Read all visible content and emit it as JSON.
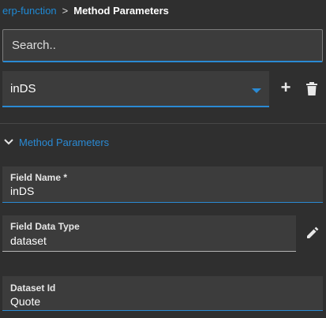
{
  "breadcrumb": {
    "parent": "erp-function",
    "separator": ">",
    "current": "Method Parameters"
  },
  "search": {
    "placeholder": "Search..",
    "value": ""
  },
  "dataset_select": {
    "value": "inDS",
    "caret_icon": "caret-down-icon"
  },
  "actions": {
    "add_icon": "plus-icon",
    "add_label": "+",
    "delete_icon": "trash-icon"
  },
  "section": {
    "title": "Method Parameters",
    "icon": "chevron-down-icon",
    "expanded": true
  },
  "fields": {
    "field_name": {
      "label": "Field Name *",
      "value": "inDS"
    },
    "field_data_type": {
      "label": "Field Data Type",
      "value": "dataset",
      "edit_icon": "pencil-icon"
    },
    "dataset_id": {
      "label": "Dataset Id",
      "value": "Quote"
    }
  },
  "colors": {
    "background": "#2f2f2f",
    "field_bg": "#3c3c3c",
    "accent": "#2a8ad4"
  }
}
